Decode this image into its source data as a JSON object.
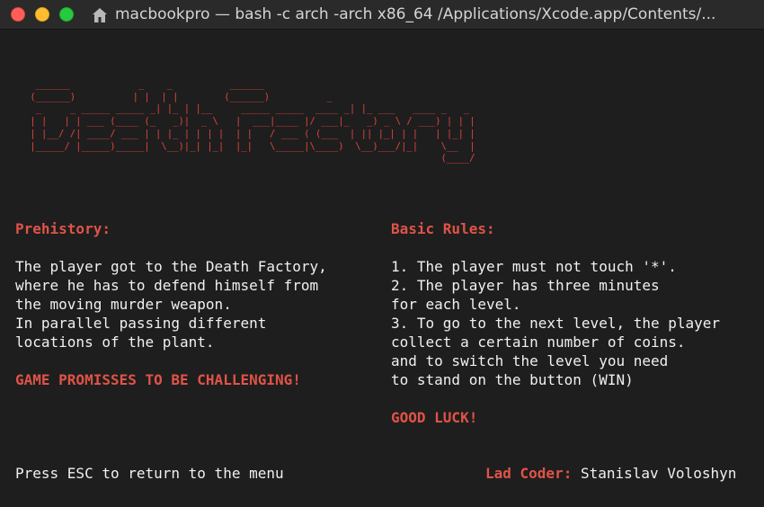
{
  "window": {
    "title": "macbookpro — bash -c arch -arch x86_64 /Applications/Xcode.app/Contents/..."
  },
  "ascii_art": {
    "lines": [
      "  ______            _    _          ______                                      ",
      " (______)          | |  | |        (______)          _                        ",
      "  _     _ _____ _____ _| |_ | |__     _____ _____  ____ _| |_ ___   ____ _   _ ",
      " | |   | | ___ (____ (_   _)|  _ \\   |  ___|____ |/ ___|_   _) _ \\ / ___) | | |",
      " | |__/ /| ____/ ___ | | |_ | | | |  | |   / ___ ( (___  | || |_| | |   | |_| |",
      " |_____/ |_____)_____|  \\__)|_| |_|  |_|   \\_____|\\____)  \\__)___/|_|    \\__  |",
      "                                                                         (____/ "
    ]
  },
  "left": {
    "heading": "Prehistory:",
    "lines": [
      "The player got to the Death Factory,",
      "where he has to defend himself from",
      "the moving murder weapon.",
      "In parallel passing different",
      "locations of the plant."
    ],
    "warning": "GAME PROMISSES TO BE CHALLENGING!"
  },
  "right": {
    "heading": "Basic Rules:",
    "lines": [
      "1. The player must not touch '*'.",
      "2. The player has three minutes",
      "for each level.",
      "3. To go to the next level, the player",
      "collect a certain number of coins.",
      "and to switch the level you need",
      "to stand on the button (WIN)"
    ],
    "closing": "GOOD LUCK!"
  },
  "footer": {
    "hint": "Press ESC to return to the menu",
    "credit_label": "Lad Coder:",
    "credit_name": " Stanislav Voloshyn"
  },
  "colors": {
    "accent": "#e05347",
    "text": "#f0f0f0",
    "background": "#1e1e1e"
  }
}
